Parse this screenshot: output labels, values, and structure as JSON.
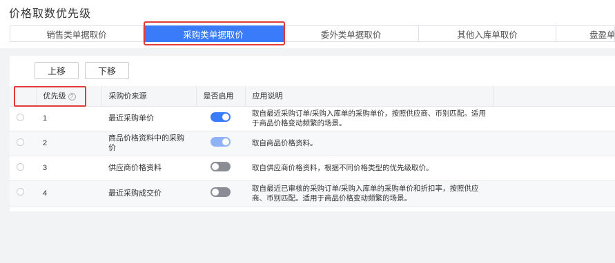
{
  "page": {
    "title": "价格取数优先级"
  },
  "tabs": [
    {
      "label": "销售类单据取价",
      "active": false
    },
    {
      "label": "采购类单据取价",
      "active": true
    },
    {
      "label": "委外类单据取价",
      "active": false
    },
    {
      "label": "其他入库单取价",
      "active": false
    },
    {
      "label": "盘盈单",
      "active": false
    }
  ],
  "toolbar": {
    "up_label": "上移",
    "down_label": "下移"
  },
  "table": {
    "columns": {
      "priority": "优先级",
      "help_icon": "?",
      "source": "采购价来源",
      "enabled": "是否启用",
      "description": "应用说明"
    },
    "rows": [
      {
        "priority": "1",
        "source": "最近采购单价",
        "enabled": "on",
        "description": "取自最近采购订单/采购入库单的采购单价，按照供应商、币别匹配。适用于商品价格变动频繁的场景。"
      },
      {
        "priority": "2",
        "source": "商品价格资料中的采购价",
        "enabled": "on-disabled",
        "description": "取自商品价格资料。"
      },
      {
        "priority": "3",
        "source": "供应商价格资料",
        "enabled": "off",
        "description": "取自供应商价格资料，根据不同价格类型的优先级取价。"
      },
      {
        "priority": "4",
        "source": "最近采购成交价",
        "enabled": "off",
        "description": "取自最近已审核的采购订单/采购入库单的采购单价和折扣率，按照供应商、币别匹配。适用于商品价格变动频繁的场景。"
      }
    ]
  },
  "colors": {
    "accent": "#3a7bfa",
    "highlight_border": "#e03b3b",
    "toggle_off": "#8a8d94"
  }
}
